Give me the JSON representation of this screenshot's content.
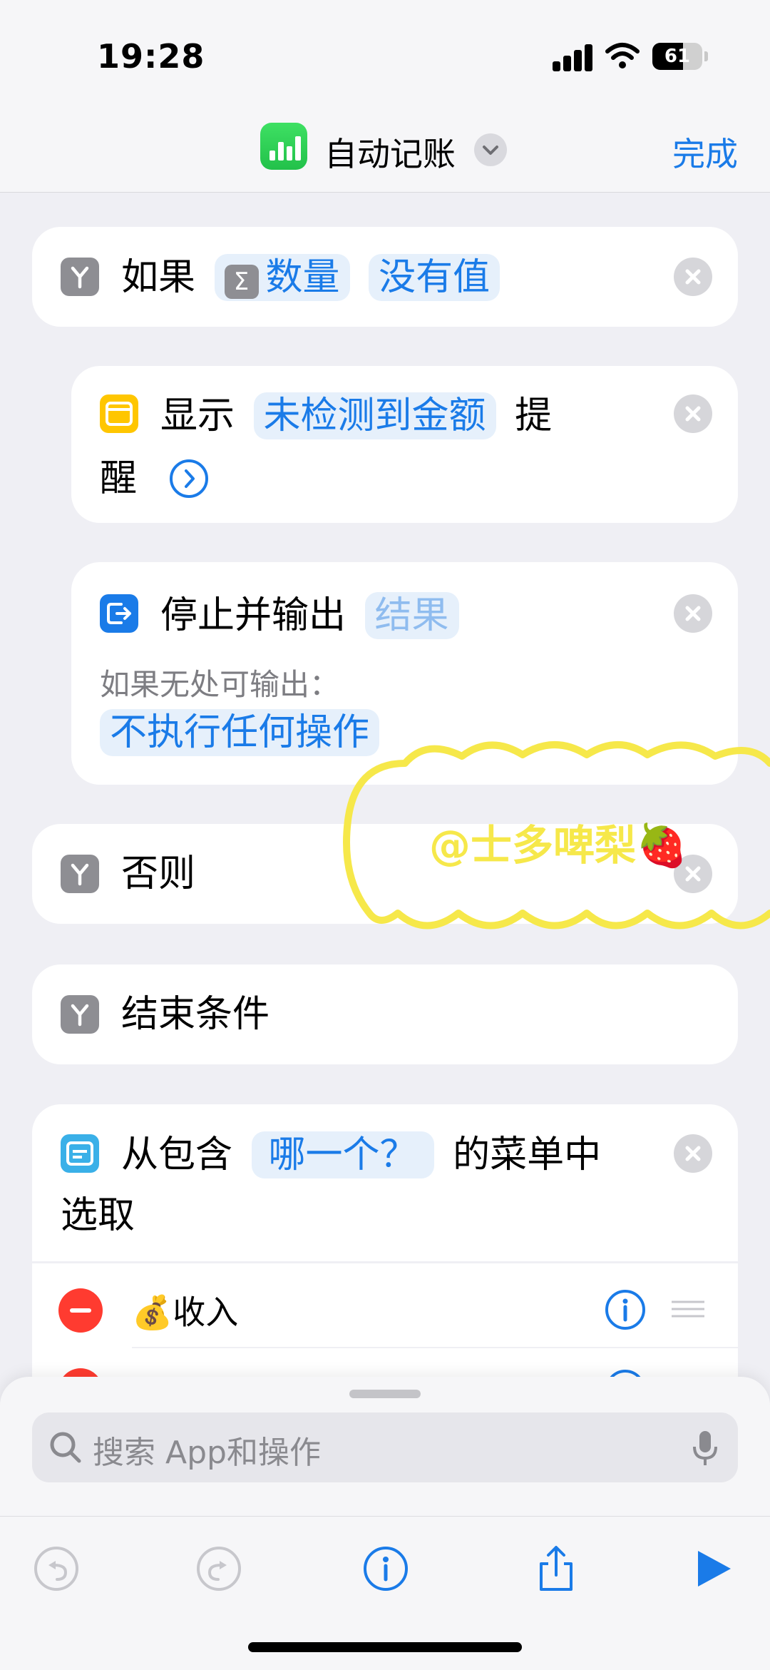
{
  "status_bar": {
    "time": "19:28",
    "battery": "61",
    "battery_level": 0.61
  },
  "nav": {
    "title": "自动记账",
    "done": "完成"
  },
  "if_block": {
    "keyword": "如果",
    "variable": "数量",
    "condition": "没有值"
  },
  "show_alert": {
    "verb": "显示",
    "value": "未检测到金额",
    "suffix_line1": "提",
    "suffix_line2": "醒"
  },
  "stop_output": {
    "title": "停止并输出",
    "value": "结果",
    "sub_label": "如果无处可输出：",
    "option": "不执行任何操作"
  },
  "otherwise": {
    "label": "否则"
  },
  "end_if": {
    "label": "结束条件"
  },
  "choose_menu": {
    "prefix": "从包含",
    "value": "哪一个？",
    "suffix_line1": "的菜单中",
    "suffix_line2": "选取",
    "items": [
      {
        "emoji": "💰",
        "label": "收入"
      }
    ]
  },
  "watermark": {
    "text": "@士多啤梨🍓"
  },
  "search": {
    "placeholder": "搜索 App和操作"
  },
  "colors": {
    "accent": "#1a7be8",
    "background": "#efeff4",
    "delete": "#ff3b30"
  },
  "icons": [
    "signal-icon",
    "wifi-icon",
    "battery-icon",
    "numbers-app-icon",
    "chevron-down-icon",
    "if-icon",
    "sigma-icon",
    "alert-icon",
    "chevron-right-icon",
    "stop-output-icon",
    "close-icon",
    "menu-icon",
    "info-icon",
    "drag-handle-icon",
    "search-icon",
    "mic-icon",
    "undo-icon",
    "redo-icon",
    "share-icon",
    "play-icon"
  ]
}
